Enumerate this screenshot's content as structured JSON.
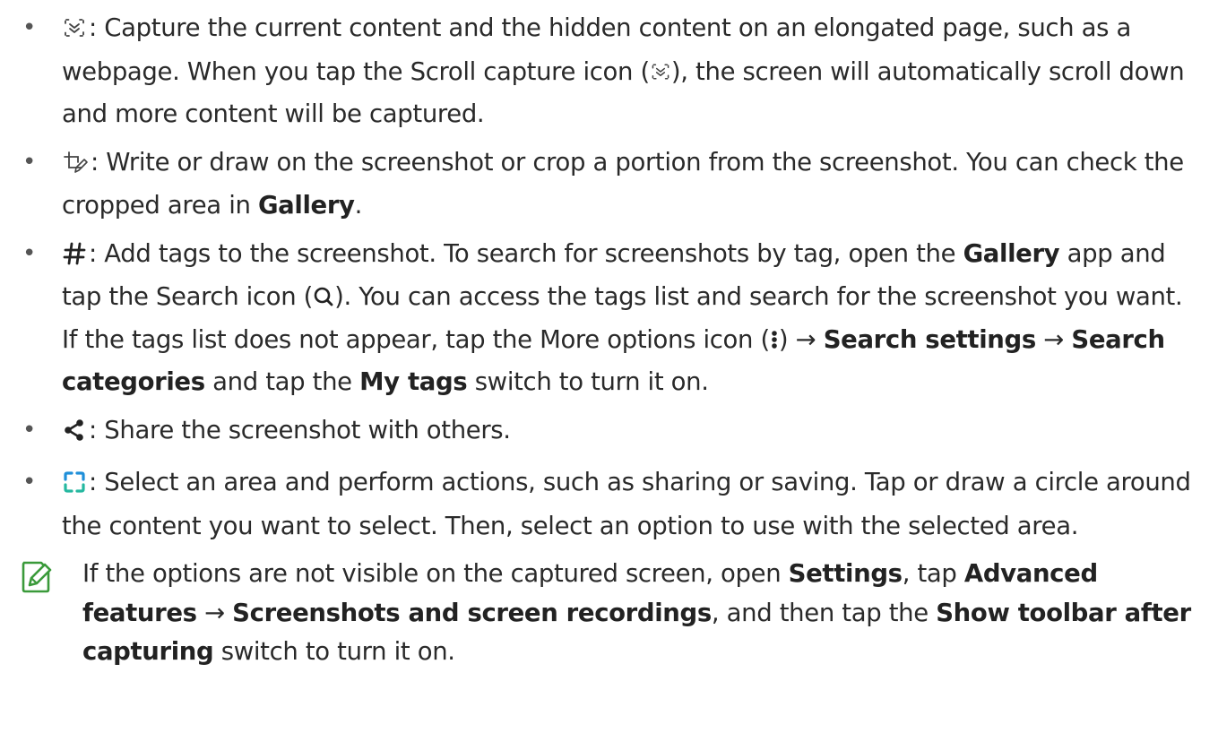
{
  "bullet_symbol": "•",
  "items": [
    {
      "icon": "scroll-capture-icon",
      "parts": {
        "p1": ": Capture the current content and the hidden content on an elongated page, such as a webpage. When you tap the Scroll capture icon (",
        "p2": "), the screen will automatically scroll down and more content will be captured."
      }
    },
    {
      "icon": "draw-crop-icon",
      "parts": {
        "p1": ": Write or draw on the screenshot or crop a portion from the screenshot. You can check the cropped area in ",
        "b1": "Gallery",
        "p2": "."
      }
    },
    {
      "icon": "hashtag-icon",
      "parts": {
        "p1": ": Add tags to the screenshot. To search for screenshots by tag, open the ",
        "b1": "Gallery",
        "p2": " app and tap the Search icon (",
        "p3": "). You can access the tags list and search for the screenshot you want. If the tags list does not appear, tap the More options icon (",
        "p4": ") → ",
        "b2": "Search settings",
        "p5": " → ",
        "b3": "Search categories",
        "p6": " and tap the ",
        "b4": "My tags",
        "p7": " switch to turn it on."
      }
    },
    {
      "icon": "share-icon",
      "parts": {
        "p1": ": Share the screenshot with others."
      }
    },
    {
      "icon": "select-area-icon",
      "parts": {
        "p1": ": Select an area and perform actions, such as sharing or saving. Tap or draw a circle around the content you want to select. Then, select an option to use with the selected area."
      }
    }
  ],
  "note": {
    "icon": "note-pencil-icon",
    "p1": "If the options are not visible on the captured screen, open ",
    "b1": "Settings",
    "p2": ", tap ",
    "b2": "Advanced features",
    "p3": " → ",
    "b3": "Screenshots and screen recordings",
    "p4": ", and then tap the ",
    "b4": "Show toolbar after capturing",
    "p5": " switch to turn it on."
  },
  "colors": {
    "text": "#2a2a2a",
    "select_icon_blue": "#1f8fd9",
    "select_icon_teal": "#25b8a0",
    "note_icon_green": "#3a9a3a"
  }
}
